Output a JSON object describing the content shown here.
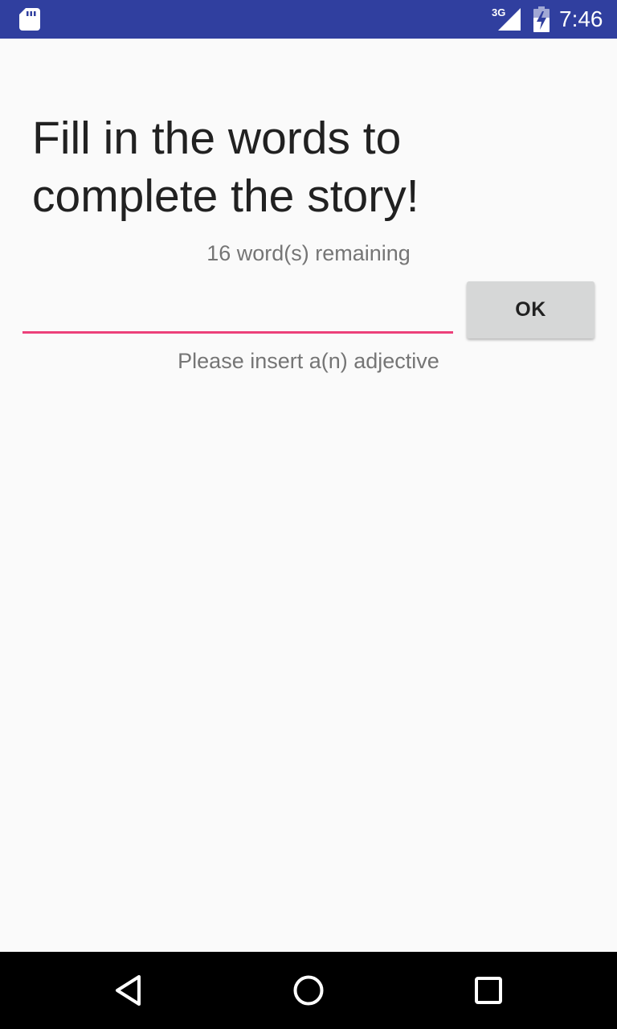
{
  "status_bar": {
    "network": "3G",
    "time": "7:46",
    "left_icon": "sd-card-icon",
    "signal_icon": "signal-icon",
    "battery_icon": "battery-charging-icon",
    "background_color": "#303f9f"
  },
  "main": {
    "title": "Fill in the words to complete the story!",
    "remaining_text": "16 word(s) remaining",
    "input_value": "",
    "ok_label": "OK",
    "hint_text": "Please insert a(n) adjective",
    "accent_color": "#ec407a"
  },
  "nav_bar": {
    "back_icon": "back-icon",
    "home_icon": "home-icon",
    "recents_icon": "recents-icon"
  }
}
